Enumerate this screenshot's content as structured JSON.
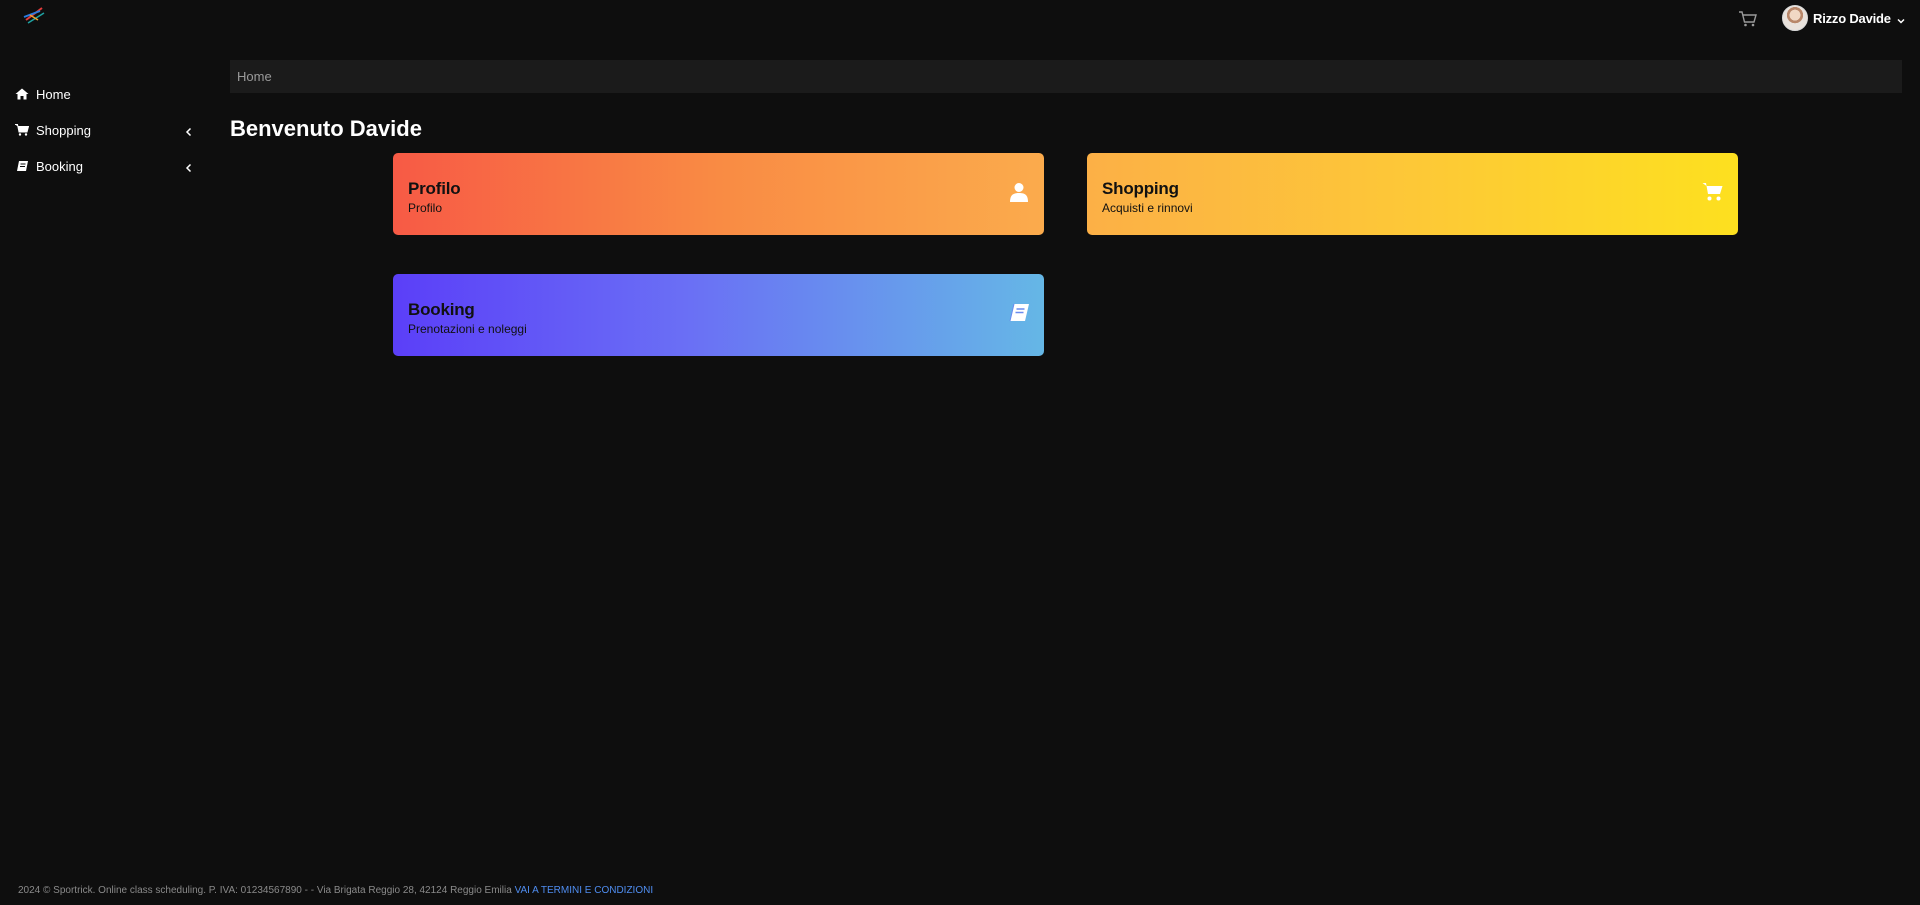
{
  "header": {
    "logo_icon": "sportrick-logo-icon",
    "cart_icon": "cart-icon",
    "user_name": "Rizzo Davide",
    "user_menu_icon": "chevron-down-icon"
  },
  "sidebar": {
    "items": [
      {
        "label": "Home",
        "icon": "home-icon",
        "expandable": false
      },
      {
        "label": "Shopping",
        "icon": "cart-icon",
        "expandable": true
      },
      {
        "label": "Booking",
        "icon": "book-icon",
        "expandable": true
      }
    ]
  },
  "breadcrumb": {
    "current": "Home"
  },
  "main": {
    "welcome": "Benvenuto Davide",
    "cards": [
      {
        "title": "Profilo",
        "subtitle": "Profilo",
        "icon": "user-icon",
        "colors": [
          "#f75a45",
          "#fbab4c"
        ]
      },
      {
        "title": "Shopping",
        "subtitle": "Acquisti e rinnovi",
        "icon": "cart-icon",
        "colors": [
          "#fcb046",
          "#fde01f"
        ]
      },
      {
        "title": "Booking",
        "subtitle": "Prenotazioni e noleggi",
        "icon": "book-icon",
        "colors": [
          "#5b3ff8",
          "#65b7e6"
        ]
      }
    ]
  },
  "footer": {
    "text": "2024 © Sportrick. Online class scheduling. P. IVA: 01234567890 - - Via Brigata Reggio 28, 42124 Reggio Emilia",
    "link": "VAI A TERMINI E CONDIZIONI",
    "link_color": "#4f8df0"
  },
  "colors": {
    "background": "#0e0e0e",
    "breadcrumb_bg": "#1b1b1b"
  }
}
